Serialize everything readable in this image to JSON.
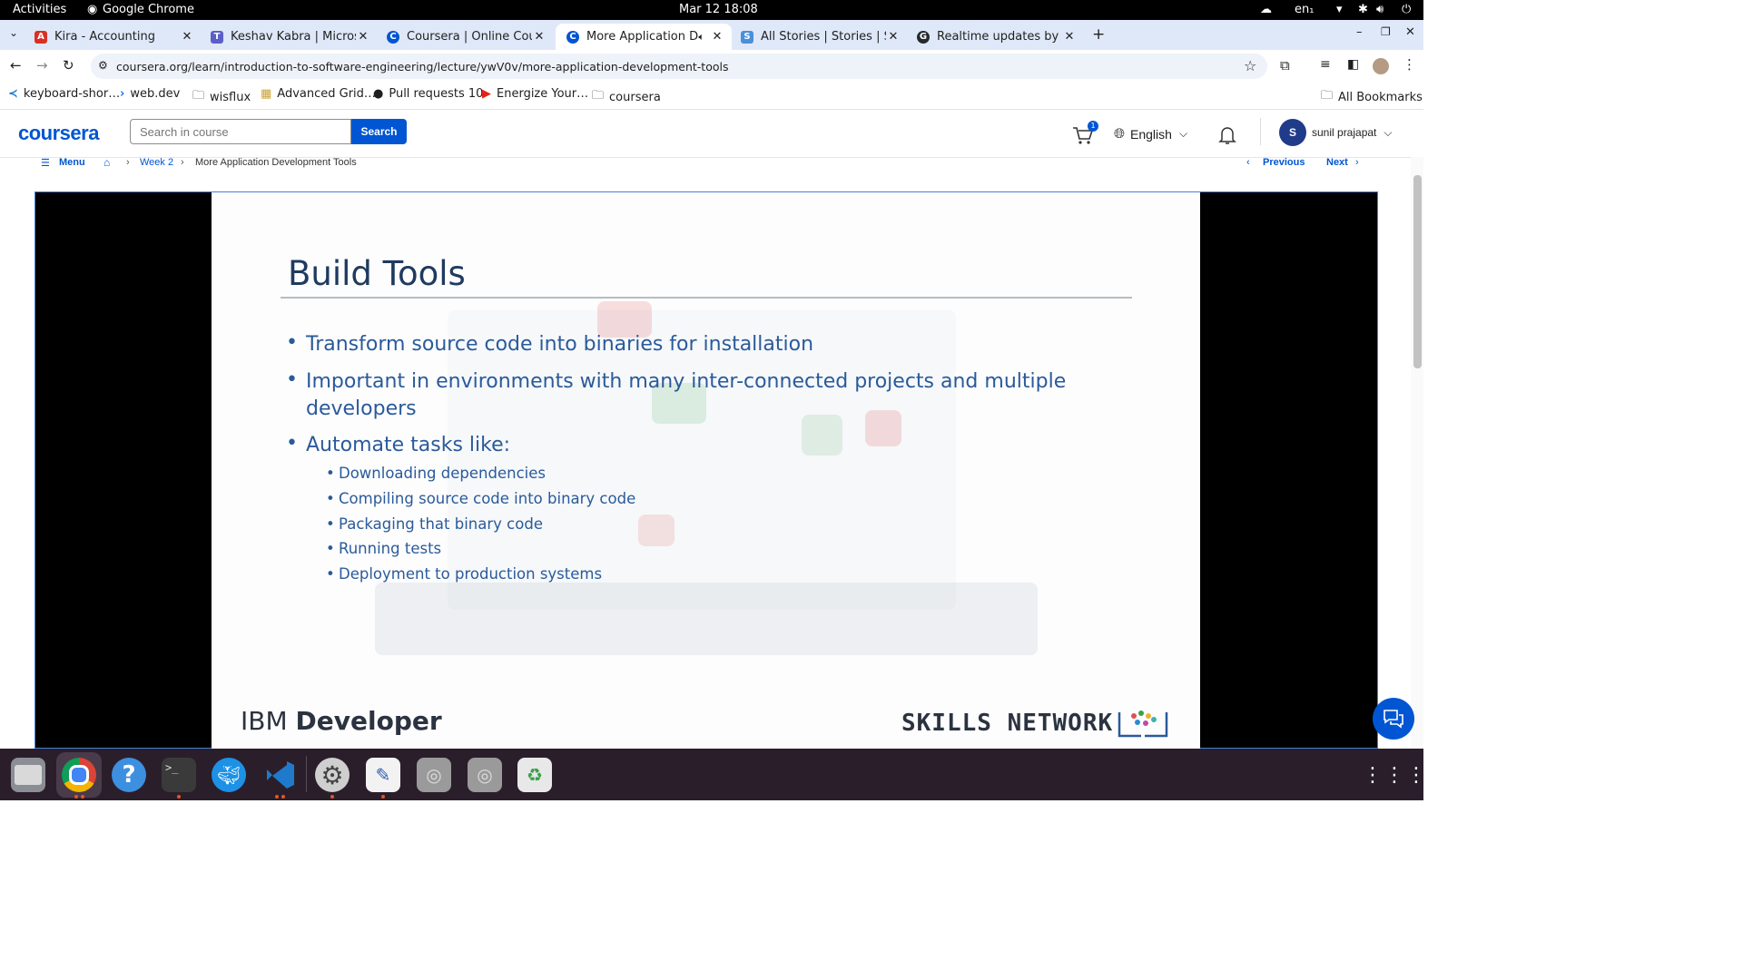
{
  "system_bar": {
    "activities": "Activities",
    "app": "Google Chrome",
    "datetime": "Mar 12  18:08",
    "lang": "en₁"
  },
  "tabs": [
    {
      "title": "Kira - Accounting",
      "color": "#d93025"
    },
    {
      "title": "Keshav Kabra | Microsof",
      "color": "#5b5fc7"
    },
    {
      "title": "Coursera | Online Cours",
      "color": "#0056d2"
    },
    {
      "title": "More Application Dev",
      "color": "#0056d2",
      "active": true
    },
    {
      "title": "All Stories | Stories | Sho",
      "color": "#4a8fd8"
    },
    {
      "title": "Realtime updates by ksv",
      "color": "#24292f"
    }
  ],
  "browser": {
    "url": "coursera.org/learn/introduction-to-software-engineering/lecture/ywV0v/more-application-development-tools"
  },
  "bookmarks": [
    {
      "label": "keyboard-shor…",
      "icon": "vscode-icon"
    },
    {
      "label": "web.dev",
      "icon": "webdev-icon"
    },
    {
      "label": "wisflux",
      "icon": "folder-icon"
    },
    {
      "label": "Advanced Grid…",
      "icon": "grid-icon"
    },
    {
      "label": "Pull requests 10",
      "icon": "github-icon"
    },
    {
      "label": "Energize Your…",
      "icon": "youtube-icon"
    },
    {
      "label": "coursera",
      "icon": "folder-icon"
    }
  ],
  "all_bookmarks": "All Bookmarks",
  "coursera": {
    "logo": "coursera",
    "search_placeholder": "Search in course",
    "search_button": "Search",
    "cart_count": "1",
    "language": "English",
    "user_initial": "S",
    "user_name": "sunil prajapat"
  },
  "breadcrumb": {
    "menu": "Menu",
    "week": "Week 2",
    "current": "More Application Development Tools",
    "previous": "Previous",
    "next": "Next"
  },
  "slide": {
    "title": "Build Tools",
    "bullets": [
      "Transform source code into binaries for installation",
      "Important in environments with many inter-connected projects and multiple developers",
      "Automate tasks like:"
    ],
    "sub_bullets": [
      "Downloading dependencies",
      "Compiling source code into binary code",
      "Packaging that binary code",
      "Running tests",
      "Deployment to production systems"
    ],
    "footer_left_light": "IBM ",
    "footer_left_bold": "Developer",
    "footer_right": "SKILLS NETWORK"
  }
}
